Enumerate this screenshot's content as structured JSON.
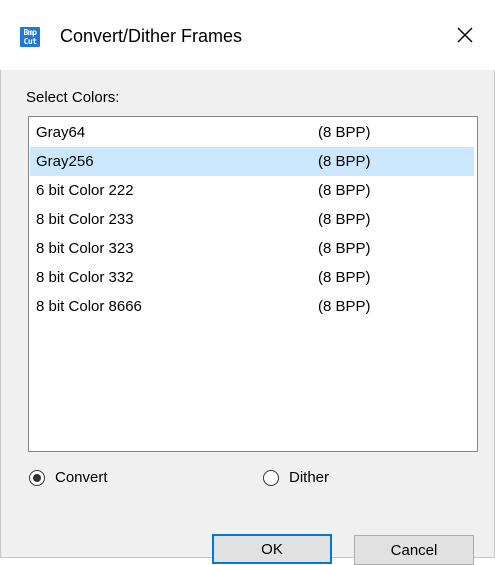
{
  "window": {
    "title": "Convert/Dither Frames",
    "icon_lines": [
      "Bmp",
      "Cut"
    ]
  },
  "colors_label": "Select Colors:",
  "colors": [
    {
      "name": "Gray64",
      "bpp": "(8 BPP)"
    },
    {
      "name": "Gray256",
      "bpp": "(8 BPP)",
      "selected": true
    },
    {
      "name": "6 bit Color 222",
      "bpp": "(8 BPP)"
    },
    {
      "name": "8 bit Color 233",
      "bpp": "(8 BPP)"
    },
    {
      "name": "8 bit Color 323",
      "bpp": "(8 BPP)"
    },
    {
      "name": "8 bit Color 332",
      "bpp": "(8 BPP)"
    },
    {
      "name": "8 bit Color 8666",
      "bpp": "(8 BPP)"
    }
  ],
  "mode": {
    "convert_label": "Convert",
    "dither_label": "Dither",
    "selected": "convert"
  },
  "buttons": {
    "ok": "OK",
    "cancel": "Cancel"
  },
  "theme": {
    "selection_color": "#cce8ff",
    "focus_color": "#0078d7",
    "icon_color": "#1b7bd6"
  }
}
